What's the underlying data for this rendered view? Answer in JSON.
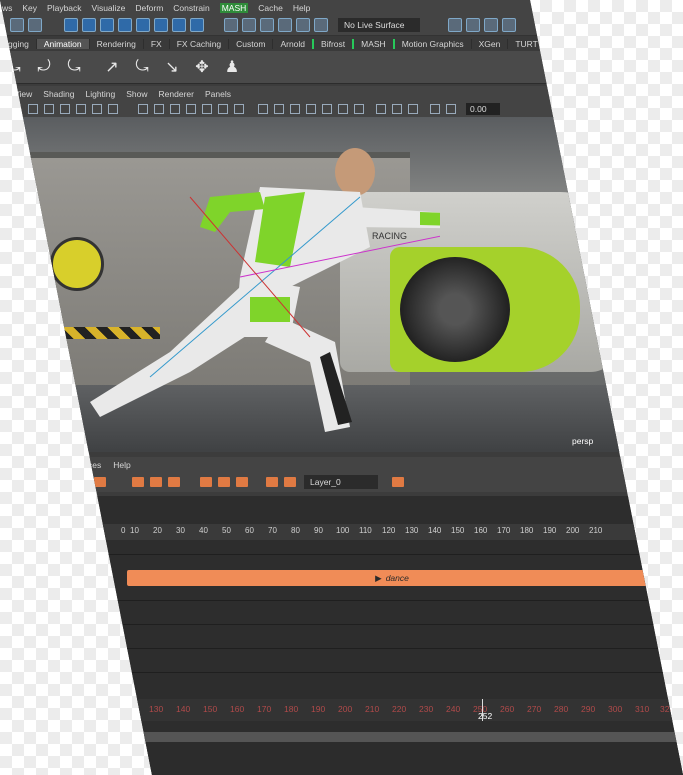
{
  "menubar": [
    "ws",
    "Key",
    "Playback",
    "Visualize",
    "Deform",
    "Constrain",
    "MASH",
    "Cache",
    "Help"
  ],
  "status": {
    "live_surface": "No Live Surface"
  },
  "shelf_tabs": [
    "gging",
    "Animation",
    "Rendering",
    "FX",
    "FX Caching",
    "Custom",
    "Arnold",
    "Bifrost",
    "MASH",
    "Motion Graphics",
    "XGen",
    "TURT"
  ],
  "shelf_tools": [
    "⤿",
    "⤾",
    "⤿",
    "↗",
    "⤿",
    "↘",
    "✥",
    "♟"
  ],
  "panel_menu": [
    "View",
    "Shading",
    "Lighting",
    "Show",
    "Renderer",
    "Panels"
  ],
  "panel_field": "0.00",
  "viewport": {
    "camera": "persp",
    "suit_text": "RACING"
  },
  "anim_menu": [
    "ces",
    "Help"
  ],
  "layer": "Layer_0",
  "clip": {
    "name": "dance"
  },
  "ruler_ticks": [
    "0",
    "10",
    "20",
    "30",
    "40",
    "50",
    "60",
    "70",
    "80",
    "90",
    "100",
    "110",
    "120",
    "130",
    "140",
    "150",
    "160",
    "170",
    "180",
    "190",
    "200",
    "210"
  ],
  "time_ticks": [
    "130",
    "140",
    "150",
    "160",
    "170",
    "180",
    "190",
    "200",
    "210",
    "220",
    "230",
    "240",
    "250",
    "260",
    "270",
    "280",
    "290",
    "300",
    "310",
    "320",
    "330"
  ],
  "current_frame": "252",
  "colors": {
    "accent_green": "#27c95a",
    "clip_orange": "#f08c57",
    "selection_blue": "#2f6aa8"
  }
}
